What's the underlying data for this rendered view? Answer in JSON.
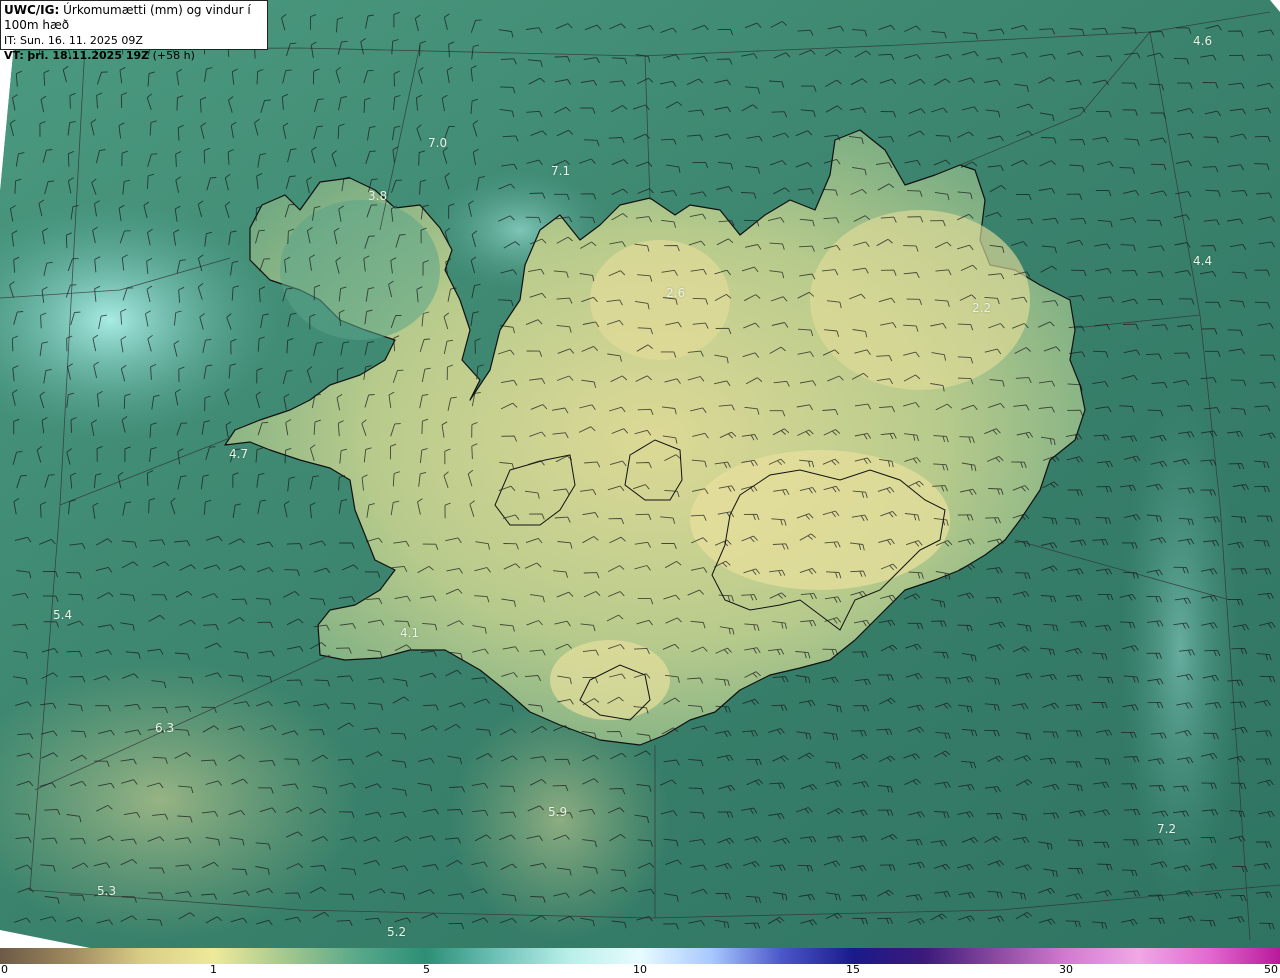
{
  "header": {
    "model": "UWC/IG:",
    "title": "Úrkomumætti (mm) og vindur í 100m hæð",
    "issue_time": "IT: Sun. 16. 11. 2025 09Z",
    "valid_prefix": "VT:",
    "valid_time": "þri. 18.11.2025 19Z",
    "lead_time": "(+58 h)"
  },
  "value_labels": [
    "7.0",
    "7.1",
    "3.8",
    "2.6",
    "2.2",
    "4.6",
    "4.4",
    "4.7",
    "5.4",
    "4.1",
    "6.3",
    "5.9",
    "7.2",
    "5.3",
    "5.2"
  ],
  "colorbar": {
    "ticks": [
      "0",
      "1",
      "5",
      "10",
      "15",
      "30",
      "50"
    ],
    "colors": [
      "#6b5a46",
      "#a08a60",
      "#d9cd86",
      "#eeea9a",
      "#a6c88e",
      "#5aa98a",
      "#2c8f76",
      "#6fc2b8",
      "#b8efe8",
      "#e8fbff",
      "#a8c8ff",
      "#4b56c8",
      "#1a1a8a",
      "#3b1a7a",
      "#8a4aa0",
      "#d27ad0",
      "#f0a8e6",
      "#e26ad0",
      "#b81a9a"
    ]
  },
  "colors": {
    "ocean": "#3f8a74",
    "ocean_dark": "#2f6e5e",
    "ocean_light": "#7fd4cc",
    "land_dry": "#d7d590",
    "land_mid": "#9cbf86",
    "coast": "#111111",
    "barb": "#1a1a1a"
  }
}
